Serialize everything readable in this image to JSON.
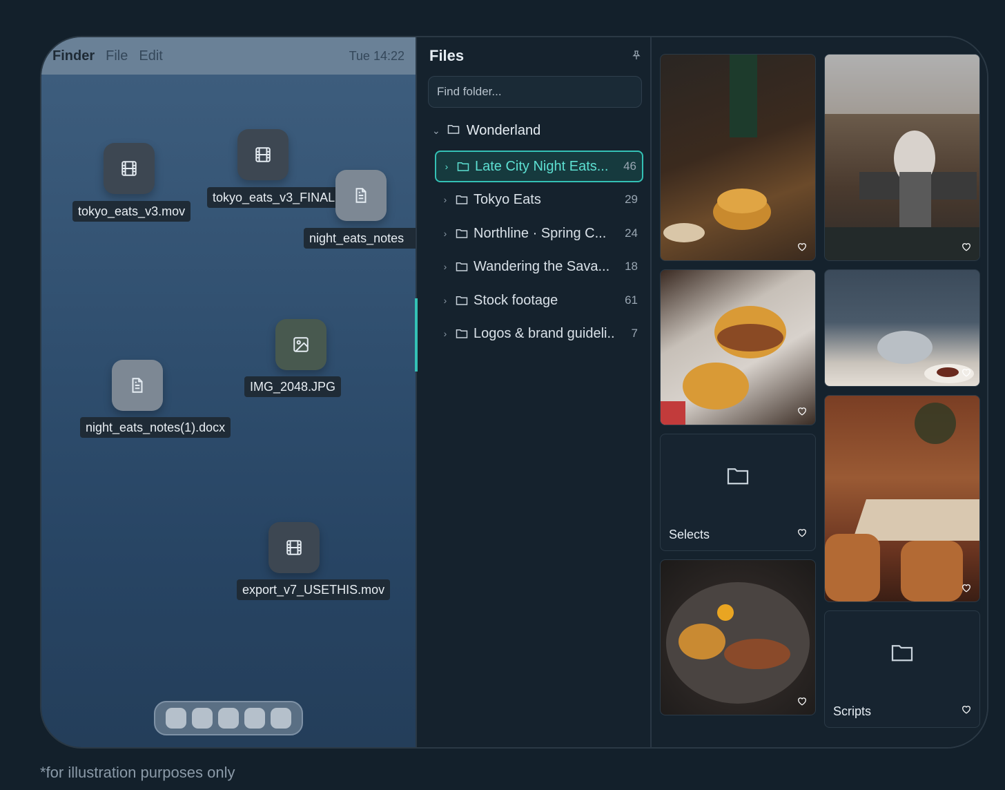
{
  "menubar": {
    "app": "Finder",
    "items": [
      "File",
      "Edit"
    ],
    "clock": "Tue 14:22"
  },
  "desktop_items": [
    {
      "label": "tokyo_eats_v3.mov",
      "icon": "film-icon"
    },
    {
      "label": "tokyo_eats_v3_FINAL",
      "icon": "film-icon"
    },
    {
      "label": "night_eats_notes",
      "icon": "document-icon"
    },
    {
      "label": "IMG_2048.JPG",
      "icon": "image-icon"
    },
    {
      "label": "night_eats_notes(1).docx",
      "icon": "document-icon"
    },
    {
      "label": "export_v7_USETHIS.mov",
      "icon": "film-icon"
    }
  ],
  "dock": {
    "count": 5
  },
  "files": {
    "title": "Files",
    "search_placeholder": "Find folder...",
    "root": "Wonderland",
    "folders": [
      {
        "name": "Late City Night Eats...",
        "count": "46",
        "active": true
      },
      {
        "name": "Tokyo Eats",
        "count": "29"
      },
      {
        "name": "Northline · Spring C...",
        "count": "24"
      },
      {
        "name": "Wandering the Sava...",
        "count": "18"
      },
      {
        "name": "Stock footage",
        "count": "61"
      },
      {
        "name": "Logos & brand guideli...",
        "count": "7"
      }
    ]
  },
  "gallery": {
    "folders": [
      "Selects",
      "Scripts"
    ]
  },
  "caption": "*for illustration purposes only",
  "colors": {
    "accent": "#34c1b5",
    "background": "#13202b"
  }
}
